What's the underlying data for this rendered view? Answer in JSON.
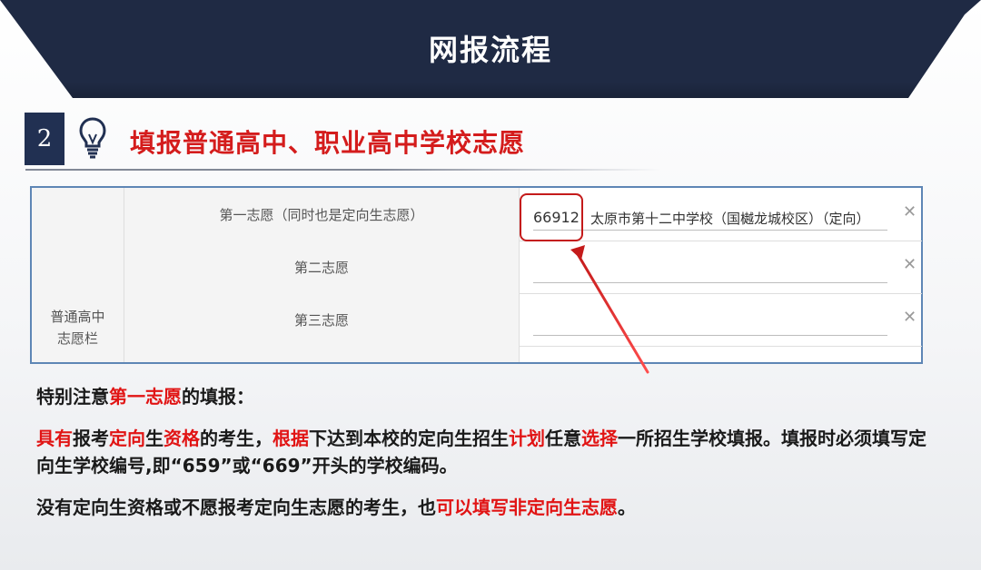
{
  "header": {
    "title": "网报流程"
  },
  "section": {
    "step": "2",
    "icon": "lightbulb-icon",
    "title": "填报普通高中、职业高中学校志愿"
  },
  "form": {
    "group_label": "普通高中志愿栏",
    "rows": [
      {
        "label": "第一志愿（同时也是定向生志愿）",
        "code": "66912",
        "school": "太原市第十二中学校（国樾龙城校区）（定向）",
        "clear": "✕"
      },
      {
        "label": "第二志愿",
        "code": "",
        "school": "",
        "clear": "✕"
      },
      {
        "label": "第三志愿",
        "code": "",
        "school": "",
        "clear": "✕"
      }
    ]
  },
  "notes": {
    "line1": [
      "特别注意",
      "第一志愿",
      "的填报："
    ],
    "line2": [
      "具有",
      "报考",
      "定向",
      "生",
      "资格",
      "的考生，",
      "根据",
      "下达到本校的定向生招生",
      "计划",
      "任意",
      "选择",
      "一所招生学校填报。填报时必须填写定向生学校编号,即“659”或“669”开头的学校编码。"
    ],
    "line3": [
      "没有定向生资格或不愿报考定向生志愿的考生，也",
      "可以填写非定向生志愿",
      "。"
    ]
  },
  "colors": {
    "banner": "#1f2a44",
    "accent_red": "#e11414",
    "frame_blue": "#5e86b5"
  }
}
